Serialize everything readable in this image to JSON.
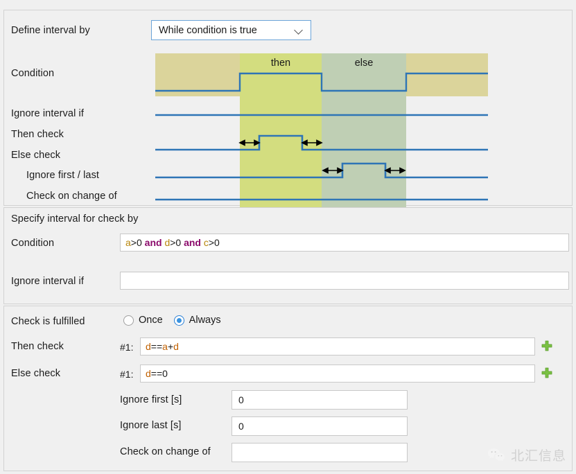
{
  "interval_section": {
    "define_label": "Define interval by",
    "dropdown_value": "While condition is true",
    "rows": [
      {
        "label": "Condition"
      },
      {
        "label": "Ignore interval if"
      },
      {
        "label": "Then check"
      },
      {
        "label": "Else check"
      },
      {
        "label": "Ignore first / last"
      },
      {
        "label": "Check on change of"
      }
    ],
    "diagram": {
      "then_label": "then",
      "else_label": "else",
      "colors": {
        "outside_band": "#dbd49b",
        "then_band": "#d3dd7f",
        "else_band": "#bfcfb4",
        "signal": "#2e75b6"
      }
    }
  },
  "specify_section": {
    "title": "Specify interval for check by",
    "condition_label": "Condition",
    "condition_value": "a>0 and d>0 and c>0",
    "condition_tokens": [
      {
        "text": "a",
        "type": "var"
      },
      {
        "text": ">0 ",
        "type": "op"
      },
      {
        "text": "and",
        "type": "kw"
      },
      {
        "text": " ",
        "type": "op"
      },
      {
        "text": "d",
        "type": "var"
      },
      {
        "text": ">0 ",
        "type": "op"
      },
      {
        "text": "and",
        "type": "kw"
      },
      {
        "text": " ",
        "type": "op"
      },
      {
        "text": "c",
        "type": "var"
      },
      {
        "text": ">0",
        "type": "op"
      }
    ],
    "ignore_interval_label": "Ignore interval if",
    "ignore_interval_value": ""
  },
  "check_section": {
    "fulfilled_label": "Check is fulfilled",
    "radios": [
      {
        "label": "Once",
        "selected": false
      },
      {
        "label": "Always",
        "selected": true
      }
    ],
    "then_check_label": "Then check",
    "then_check_index": "#1:",
    "then_check_value": "d==a+d",
    "else_check_label": "Else check",
    "else_check_index": "#1:",
    "else_check_value": "d==0",
    "add_button_label": "+",
    "ignore_first_label": "Ignore first [s]",
    "ignore_first_value": "0",
    "ignore_last_label": "Ignore last [s]",
    "ignore_last_value": "0",
    "check_change_label": "Check on change of",
    "check_change_value": ""
  },
  "watermark": {
    "text": "北汇信息",
    "icon": "wechat-icon"
  }
}
